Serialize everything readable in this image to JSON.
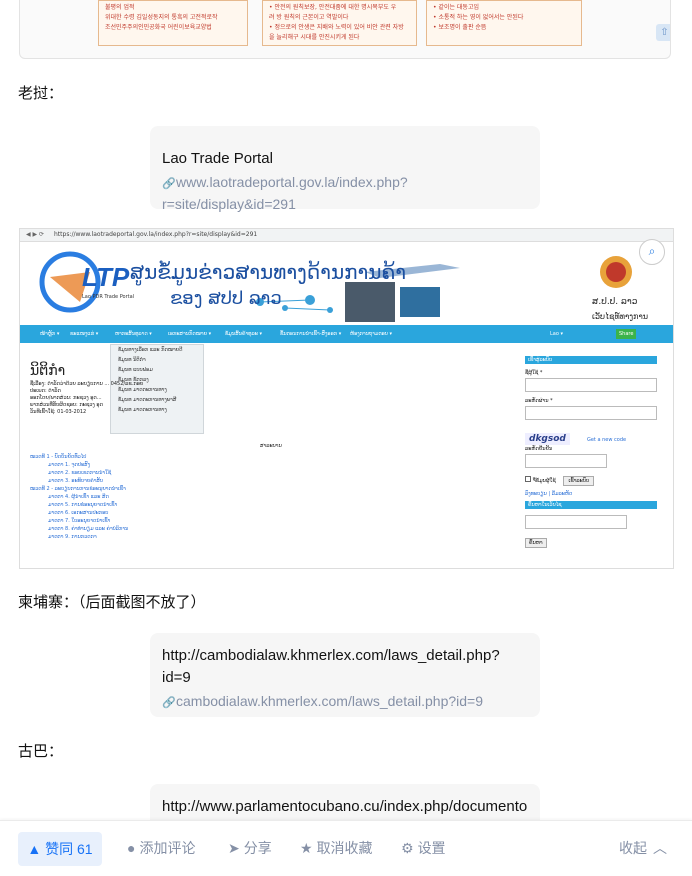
{
  "top_image": {
    "col1": [
      "불평의 업적",
      "위대한 수령 김일성동지의 통흑의 고전적로작",
      "조선민주주의인민공화국 어린이보육교양법"
    ],
    "col2": [
      "• 안전의 원칙보장, 안전대줌에 대한 명시목부도 우",
      "  려 방 원칙의 근본이고 역발이다",
      "• 정으로의 안생은 지배와 노력이 있어 비안 관련 자방",
      "  을 늘리해구 시대를 안진시키게 된다"
    ],
    "col3": [
      "• 같이는 대동고임",
      "• 소통적 하는 영이 없어서는 안된다",
      "• 보조명이 출판 순뜸"
    ]
  },
  "sections": {
    "laos_label": "老挝：",
    "cambodia_label": "柬埔寨：（后面截图不放了）",
    "cuba_label": "古巴："
  },
  "cards": {
    "lao": {
      "title": "Lao Trade Portal",
      "url": "www.laotradeportal.gov.la/index.php?r=site/display&id=291"
    },
    "cambodia": {
      "title": "http://cambodialaw.khmerlex.com/laws_detail.php?id=9",
      "url": "cambodialaw.khmerlex.com/laws_detail.php?id=9"
    },
    "cuba": {
      "title": "http://www.parlamentocubano.cu/index.php/documento"
    }
  },
  "lao_screenshot": {
    "address": "https://www.laotradeportal.gov.la/index.php?r=site/display&id=291",
    "logo_text": "LTP",
    "logo_sub": "Lao PDR Trade Portal",
    "banner_title": "ສູນຂໍ້ມູນຂ່າວສານທາງດ້ານການຄ້າ",
    "banner_sub": "ຂອງ ສປປ ລາວ",
    "gov_line1": "ສ.ປ.ປ. ລາວ",
    "gov_line2": "ເວັບໄຊທ໌ທາງການ",
    "nav_items": [
      "ໜ້າຫຼັກ ▾",
      "ຂະແໜງແຮ່ ▾",
      "ຫາກະສິ້ນທຸລາດ ▾",
      "ເອກະສານກົດໝາຍ ▾",
      "ຂໍ້ມູນສິ້ນຄ້າທຸລະ ▾",
      "ຂັ້ນຕອນການນໍາເຂົ້າ-ສົ່ງອອກ ▾",
      "ຫ້ອງການຖາມຕອບ ▾",
      "Lao ▾",
      "Share"
    ],
    "dropdown": [
      "ຂໍ້ມູນທາງເລືອກ ແລະ ກົດໝາຍດີ",
      "ຂໍ້ມູນທ ນິຕິກໍາ",
      "ຂໍ້ມູນທ ແບບຟອມ",
      "ຂໍ້ມູນທ ຂໍ້ຕກລງ",
      "ຂໍ້ມູນທ ມາດຕະການທາງ",
      "ຂໍ້ມູນທ ມາດຕະການທາງພາສີ",
      "ຂໍ້ມູນທ ມາດຕະການທາງ"
    ],
    "page_heading": "ນິຕິກໍາ",
    "meta": [
      "ຊື່ເລື່ອງ: ດໍາລັດວ່າດ້ວຍ ລະບຽບການ ... 0452/ລຂ.ກອຍ",
      "ປະເພດ: ດໍາລັດ",
      "ອອກໂດຍ/ພາກສ່ວນ: ກະຊວງ ອຸດ...",
      "ພາກສ່ວນທີ່ຮັບຜິດຊອບ: ກະຊວງ ອຸດ",
      "ວັນທີເຂົ້າໃຊ້: 01-03-2012"
    ],
    "toc_title": "ສາລະບານ",
    "toc": [
      "ໝວດທີ 1 - ບົດບັນຍັດທົ່ວໄປ",
      "ມາດຕາ 1. ຈຸດປະສົງ",
      "ມາດຕາ 2. ຂອບເຂດການນຳໃຊ້",
      "ມາດຕາ 3. ອະທິບາຍຄໍາສັບ",
      "ໝວດທີ 2 - ລະບຽບການການຂໍອະນຸຍາດນໍາເຂົ້າ",
      "ມາດຕາ 4. ຜູ້ນໍາເຂົ້າ ແລະ ສິດ",
      "ມາດຕາ 5. ການຂໍອະນຸຍາດນໍາເຂົ້າ",
      "ມາດຕາ 6. ເອກະສານປະກອບ",
      "ມາດຕາ 7. ໃບອະນຸຍາດນໍາເຂົ້າ",
      "ມາດຕາ 8. ຄ່າທໍານຽມ ແລະ ຄ່າບໍລິການ",
      "ມາດຕາ 9. ການກວດກາ"
    ],
    "side_title": "ເຂົ້າສູ່ລະບົບ",
    "side_labels": [
      "ຊື່ຜູ້ໃຊ້ *",
      "ລະຫັດຜ່ານ *",
      "ລະຫັດຢືນຢັນ"
    ],
    "captcha": "dkgsod",
    "captcha_link": "Get a new code",
    "remember": "ຈື່ຂໍ້ມູນຜູ້ໃຊ້",
    "login_btn": "ເຂົ້າລະບົບ",
    "side_links": "ລົງທະບຽນ | ລືມລະຫັດ",
    "search_title": "ຄົ້ນຫາໃນເວັບໄຊ",
    "search_btn": "ຄົ້ນຫາ"
  },
  "toolbar": {
    "vote": "▲ 赞同 61",
    "comment": "添加评论",
    "share": "分享",
    "unfavorite": "取消收藏",
    "settings": "设置",
    "collapse": "收起"
  },
  "colors": {
    "accent": "#1772f6",
    "muted": "#8590a6",
    "lao_nav": "#2aa6dd"
  }
}
